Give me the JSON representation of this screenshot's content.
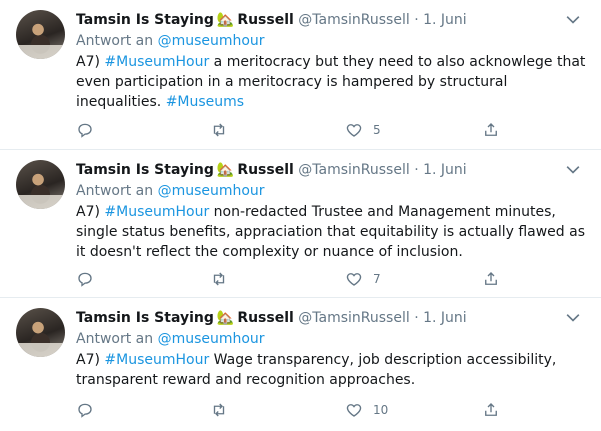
{
  "tweets": [
    {
      "name": "Tamsin Is Staying",
      "house": "🏡",
      "name2": "Russell",
      "handle": "@TamsinRussell",
      "dot": "·",
      "date": "1. Juni",
      "reply_prefix": "Antwort an ",
      "reply_to": "@museumhour",
      "body": {
        "p1": "A7) ",
        "tag1": "#MuseumHour",
        "p2": " a meritocracy but they need to also acknowlege that even participation in a meritocracy is hampered by structural inequalities. ",
        "tag2": "#Museums"
      },
      "likes": "5"
    },
    {
      "name": "Tamsin Is Staying",
      "house": "🏡",
      "name2": "Russell",
      "handle": "@TamsinRussell",
      "dot": "·",
      "date": "1. Juni",
      "reply_prefix": "Antwort an ",
      "reply_to": "@museumhour",
      "body": {
        "p1": "A7) ",
        "tag1": "#MuseumHour",
        "p2": " non-redacted Trustee and Management minutes, single status benefits, appraciation that equitability is actually flawed as it doesn't reflect the complexity or nuance of inclusion.",
        "tag2": ""
      },
      "likes": "7"
    },
    {
      "name": "Tamsin Is Staying",
      "house": "🏡",
      "name2": "Russell",
      "handle": "@TamsinRussell",
      "dot": "·",
      "date": "1. Juni",
      "reply_prefix": "Antwort an ",
      "reply_to": "@museumhour",
      "body": {
        "p1": "A7) ",
        "tag1": "#MuseumHour",
        "p2": " Wage transparency, job description accessibility, transparent reward and recognition approaches.",
        "tag2": ""
      },
      "likes": "10"
    }
  ],
  "icons": {
    "reply": "reply-icon",
    "retweet": "retweet-icon",
    "like": "heart-icon",
    "share": "share-icon",
    "more": "chevron-down-icon"
  },
  "colors": {
    "link": "#1b95e0",
    "secondary": "#657786",
    "text": "#14171a",
    "divider": "#e6ecf0"
  }
}
